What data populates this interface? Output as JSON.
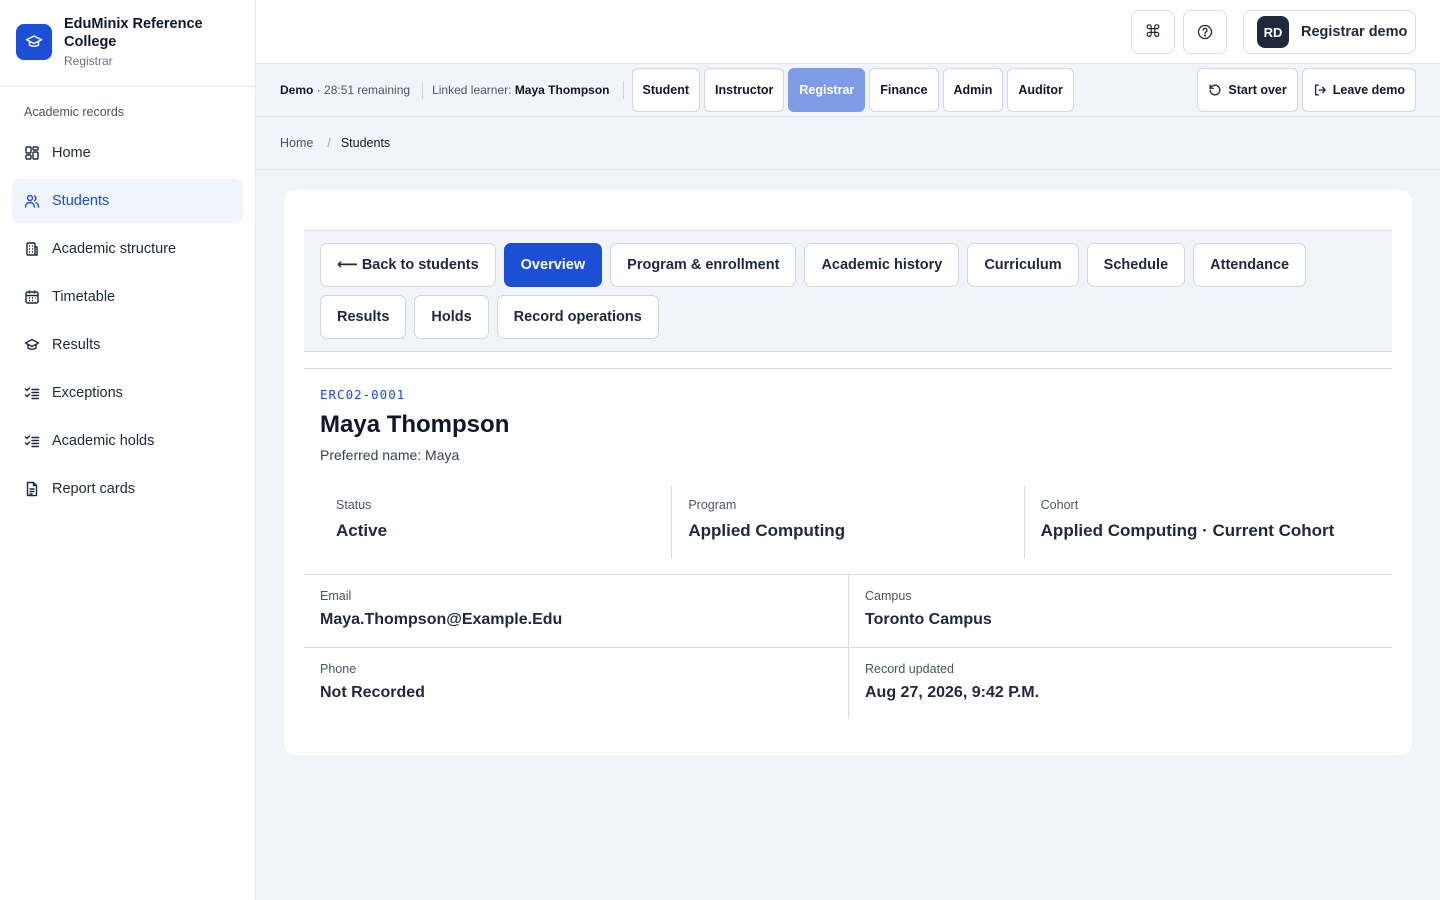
{
  "brand": {
    "name": "EduMinix Reference College",
    "role": "Registrar"
  },
  "sidebar": {
    "section": "Academic records",
    "items": [
      {
        "label": "Home",
        "icon": "dashboard-icon"
      },
      {
        "label": "Students",
        "icon": "users-icon"
      },
      {
        "label": "Academic structure",
        "icon": "building-icon"
      },
      {
        "label": "Timetable",
        "icon": "calendar-icon"
      },
      {
        "label": "Results",
        "icon": "graduation-cap-icon"
      },
      {
        "label": "Exceptions",
        "icon": "checklist-icon"
      },
      {
        "label": "Academic holds",
        "icon": "checklist-icon"
      },
      {
        "label": "Report cards",
        "icon": "document-icon"
      }
    ],
    "active": "Students"
  },
  "topbar": {
    "user_initials": "RD",
    "user_name": "Registrar demo",
    "command_glyph": "⌘"
  },
  "demo": {
    "label": "Demo",
    "remaining": "· 28:51 remaining",
    "linked_label": "Linked learner:",
    "linked_name": "Maya Thompson",
    "roles": [
      "Student",
      "Instructor",
      "Registrar",
      "Finance",
      "Admin",
      "Auditor"
    ],
    "active_role": "Registrar",
    "start_over": "Start over",
    "leave": "Leave demo"
  },
  "breadcrumb": {
    "home": "Home",
    "sep": "/",
    "current": "Students"
  },
  "tabs": {
    "back": "⟵ Back to students",
    "items": [
      "Overview",
      "Program & enrollment",
      "Academic history",
      "Curriculum",
      "Schedule",
      "Attendance",
      "Results",
      "Holds",
      "Record operations"
    ],
    "active": "Overview"
  },
  "record": {
    "id": "ERC02-0001",
    "name": "Maya Thompson",
    "preferred": "Preferred name: Maya",
    "stats": [
      {
        "label": "Status",
        "value": "Active"
      },
      {
        "label": "Program",
        "value": "Applied Computing"
      },
      {
        "label": "Cohort",
        "value": "Applied Computing · Current Cohort"
      }
    ],
    "details": [
      {
        "label": "Email",
        "value": "Maya.Thompson@Example.Edu"
      },
      {
        "label": "Campus",
        "value": "Toronto Campus"
      },
      {
        "label": "Phone",
        "value": "Not Recorded"
      },
      {
        "label": "Record updated",
        "value": "Aug 27, 2026, 9:42 P.M."
      }
    ]
  },
  "colors": {
    "accent": "#1d4ed8",
    "active_role": "#7e9be8",
    "background": "#f1f5f9"
  }
}
